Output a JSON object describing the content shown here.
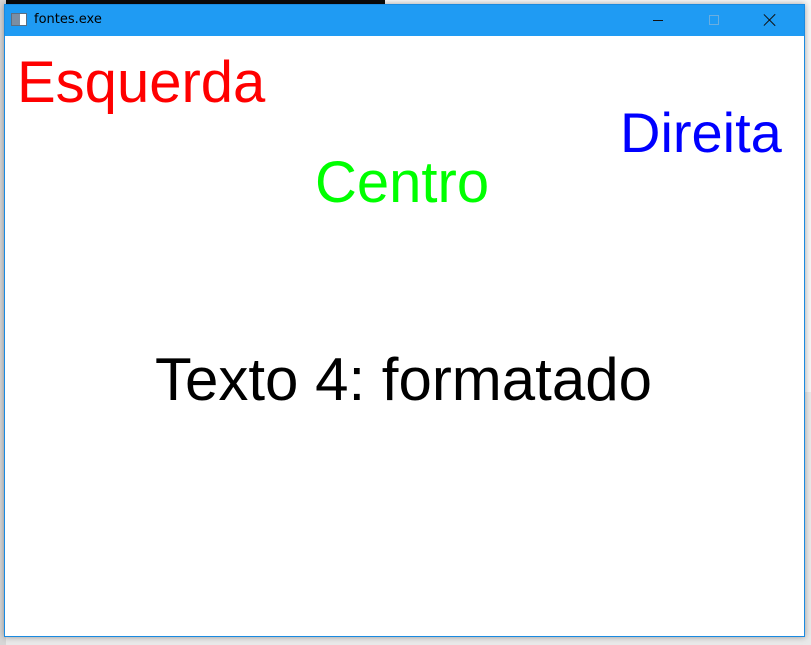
{
  "window": {
    "title": "fontes.exe",
    "title_bar_color": "#1f9bf3",
    "icon": "app-window-icon",
    "controls": {
      "minimize_icon": "minimize-icon",
      "maximize_icon": "maximize-icon",
      "close_icon": "close-icon"
    }
  },
  "content": {
    "left": {
      "text": "Esquerda",
      "color": "#ff0000"
    },
    "right": {
      "text": "Direita",
      "color": "#0000ff"
    },
    "center": {
      "text": "Centro",
      "color": "#00ff00"
    },
    "formatted": {
      "text": "Texto 4: formatado",
      "color": "#000000"
    }
  },
  "colors": {
    "client_background": "#ffffff",
    "window_border": "#1a8ae0"
  }
}
